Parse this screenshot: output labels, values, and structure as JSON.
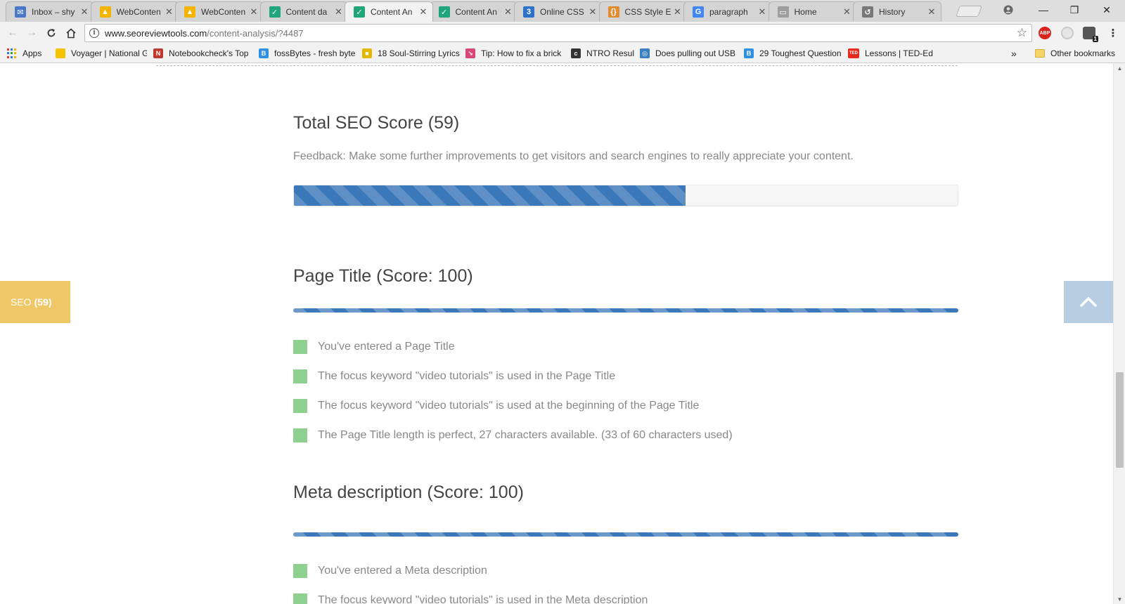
{
  "browser": {
    "tabs": [
      {
        "title": "Inbox – shy",
        "icon": "gmail-icon",
        "color": "#4a78c8",
        "glyph": "✉"
      },
      {
        "title": "WebConten",
        "icon": "drive-icon",
        "color": "#f4b400",
        "glyph": "▲"
      },
      {
        "title": "WebConten",
        "icon": "drive-icon",
        "color": "#f4b400",
        "glyph": "▲"
      },
      {
        "title": "Content da",
        "icon": "check-icon",
        "color": "#1fa67a",
        "glyph": "✓"
      },
      {
        "title": "Content An",
        "icon": "check-icon",
        "color": "#1fa67a",
        "glyph": "✓"
      },
      {
        "title": "Content An",
        "icon": "check-icon",
        "color": "#1fa67a",
        "glyph": "✓"
      },
      {
        "title": "Online CSS",
        "icon": "css-icon",
        "color": "#2f73c9",
        "glyph": "3"
      },
      {
        "title": "CSS Style E",
        "icon": "braces-icon",
        "color": "#e58b2d",
        "glyph": "{}"
      },
      {
        "title": "paragraph",
        "icon": "google-icon",
        "color": "#4285f4",
        "glyph": "G"
      },
      {
        "title": "Home",
        "icon": "page-icon",
        "color": "#9e9e9e",
        "glyph": "▭"
      },
      {
        "title": "History",
        "icon": "history-icon",
        "color": "#777777",
        "glyph": "↺"
      }
    ],
    "active_tab_index": 4,
    "close_glyph": "✕",
    "window_controls": {
      "minimize": "—",
      "restore": "❐",
      "close": "✕"
    },
    "url_host": "www.seoreviewtools.com",
    "url_path": "/content-analysis/?4487",
    "star_glyph": "☆",
    "extensions": {
      "abp_label": "ABP",
      "badge": "1"
    },
    "bookmarks": [
      {
        "label": "Apps",
        "icon": "apps-icon"
      },
      {
        "label": "Voyager | National Ge",
        "icon": "natgeo-icon",
        "color": "#f5c400",
        "glyph": ""
      },
      {
        "label": "Notebookcheck's Top",
        "icon": "notebookcheck-icon",
        "color": "#c0392b",
        "glyph": "N"
      },
      {
        "label": "fossBytes - fresh byte",
        "icon": "fossbytes-icon",
        "color": "#2f8fe0",
        "glyph": "B"
      },
      {
        "label": "18 Soul-Stirring Lyrics",
        "icon": "bookmark-icon",
        "color": "#e3b800",
        "glyph": "■"
      },
      {
        "label": "Tip: How to fix a brick",
        "icon": "tip-icon",
        "color": "#d9467a",
        "glyph": "↘"
      },
      {
        "label": "NTRO Result",
        "icon": "ntro-icon",
        "color": "#333333",
        "glyph": "c"
      },
      {
        "label": "Does pulling out USB",
        "icon": "usb-icon",
        "color": "#3a7fc1",
        "glyph": "◎"
      },
      {
        "label": "29 Toughest Question",
        "icon": "fossbytes-icon",
        "color": "#2f8fe0",
        "glyph": "B"
      },
      {
        "label": "Lessons | TED-Ed",
        "icon": "ted-icon",
        "color": "#e62b1e",
        "glyph": "TED"
      }
    ],
    "more_bookmarks": "»",
    "other_bookmarks": "Other bookmarks"
  },
  "page": {
    "total": {
      "title": "Total SEO Score (59)",
      "feedback": "Feedback: Make some further improvements to get visitors and search engines to really appreciate your content.",
      "score_fraction": 0.59
    },
    "sections": [
      {
        "title": "Page Title (Score: 100)",
        "score_fraction": 1.0,
        "items": [
          "You've entered a Page Title",
          "The focus keyword \"video tutorials\" is used in the Page Title",
          "The focus keyword \"video tutorials\" is used at the beginning of the Page Title",
          "The Page Title length is perfect, 27 characters available. (33 of 60 characters used)"
        ]
      },
      {
        "title": "Meta description (Score: 100)",
        "score_fraction": 1.0,
        "items": [
          "You've entered a Meta description",
          "The focus keyword \"video tutorials\" is used in the Meta description"
        ]
      }
    ],
    "seo_tab": {
      "label": "SEO",
      "score": "(59)"
    },
    "colors": {
      "progress": "#3a78b9",
      "check": "#8ed08e",
      "seo_tab": "#f0c767",
      "scroll_top": "#b7cde2"
    }
  }
}
